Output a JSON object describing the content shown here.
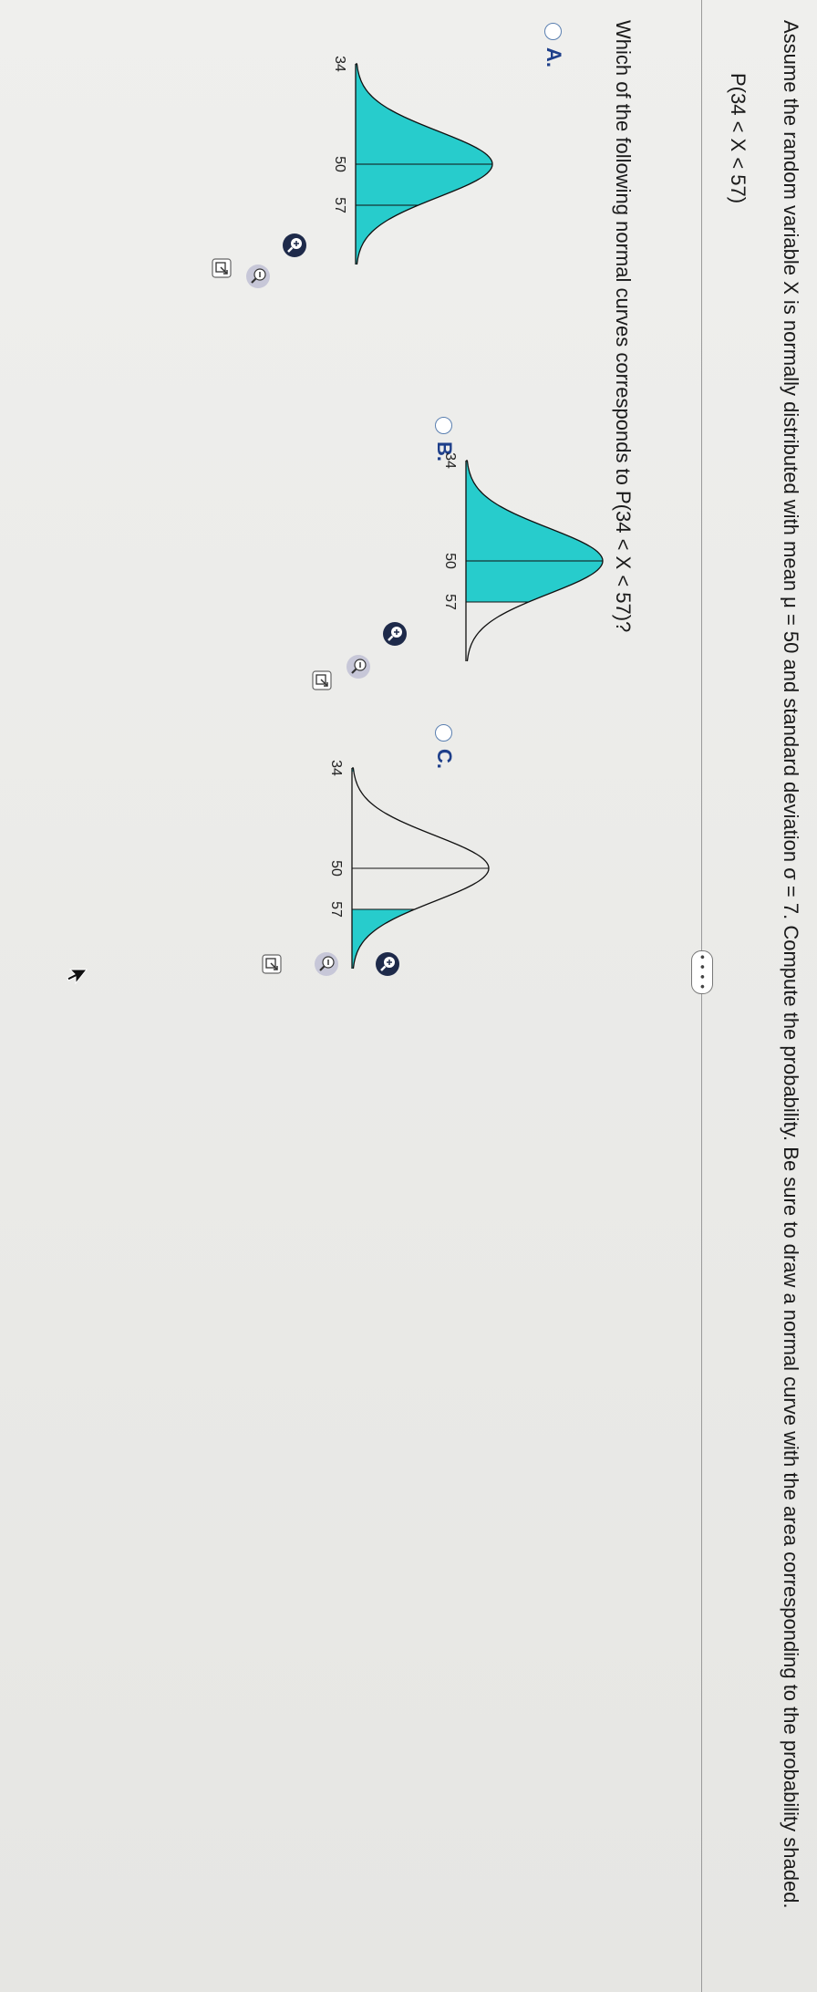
{
  "question": {
    "text": "Assume the random variable X is normally distributed with mean μ = 50 and standard deviation σ = 7. Compute the probability. Be sure to draw a normal curve with the area corresponding to the probability shaded.",
    "expression": "P(34 < X < 57)",
    "more_button": "• • • •",
    "prompt": "Which of the following normal curves corresponds to P(34 < X < 57)?"
  },
  "options": [
    {
      "label": "A.",
      "shaded": "upper_tail_from_34",
      "ticks": [
        "34",
        "50",
        "57"
      ]
    },
    {
      "label": "B.",
      "shaded": "lower_tail_to_57",
      "ticks": [
        "34",
        "50",
        "57"
      ]
    },
    {
      "label": "C.",
      "shaded": "outside_34_to_57",
      "ticks": [
        "34",
        "50",
        "57"
      ]
    }
  ],
  "tools": {
    "zoom_in": "zoom-in-icon",
    "zoom_out": "zoom-out-icon",
    "expand": "expand-icon"
  },
  "colors": {
    "shade": "#27cccc",
    "label": "#1e3f8a",
    "radio": "#5a7fb0",
    "zoom_in_bg": "#1e2a4a",
    "zoom_out_bg": "#c7c7d8"
  }
}
